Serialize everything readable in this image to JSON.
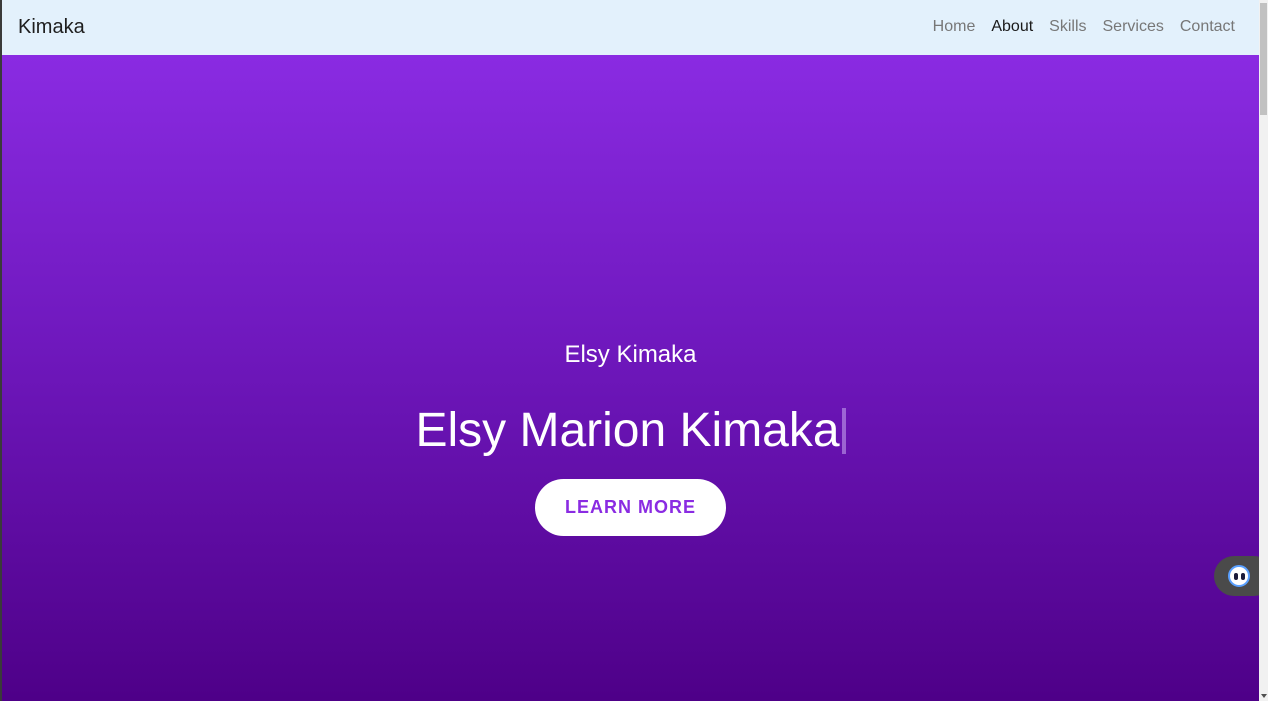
{
  "navbar": {
    "brand": "Kimaka",
    "links": [
      {
        "label": "Home",
        "active": false
      },
      {
        "label": "About",
        "active": true
      },
      {
        "label": "Skills",
        "active": false
      },
      {
        "label": "Services",
        "active": false
      },
      {
        "label": "Contact",
        "active": false
      }
    ]
  },
  "hero": {
    "subtitle": "Elsy Kimaka",
    "title": "Elsy Marion Kimaka",
    "cta_label": "LEARN MORE"
  },
  "widget": {
    "icon": "chatbot-face-icon"
  },
  "colors": {
    "accent": "#8a2be2",
    "hero_gradient_top": "#8a2be2",
    "hero_gradient_bottom": "#4e0088",
    "navbar_bg": "#e3f1fc"
  }
}
